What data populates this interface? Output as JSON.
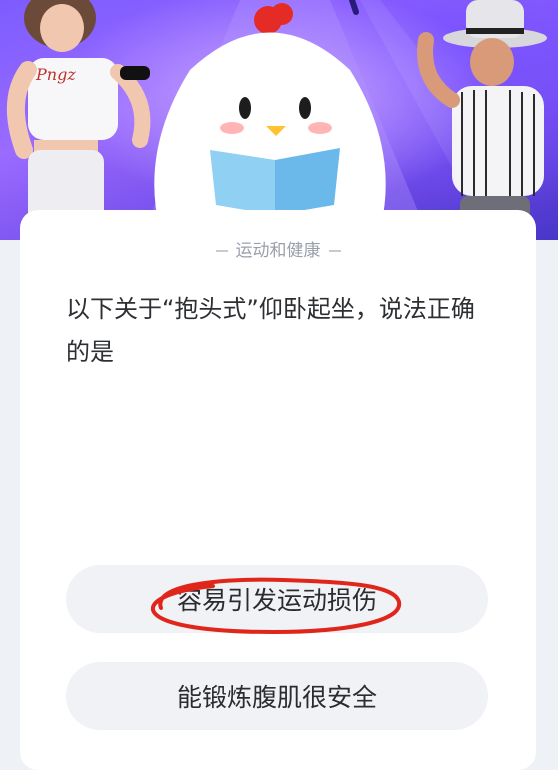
{
  "category": "运动和健康",
  "question": "以下关于“抱头式”仰卧起坐，说法正确的是",
  "options": [
    {
      "label": "容易引发运动损伤"
    },
    {
      "label": "能锻炼腹肌很安全"
    }
  ],
  "colors": {
    "banner_purple": "#7c5cff",
    "annotation_red": "#e0261b",
    "option_bg": "#f0f2f5"
  },
  "icons": [
    "woman-character",
    "chick-mascot-icon",
    "man-character"
  ]
}
